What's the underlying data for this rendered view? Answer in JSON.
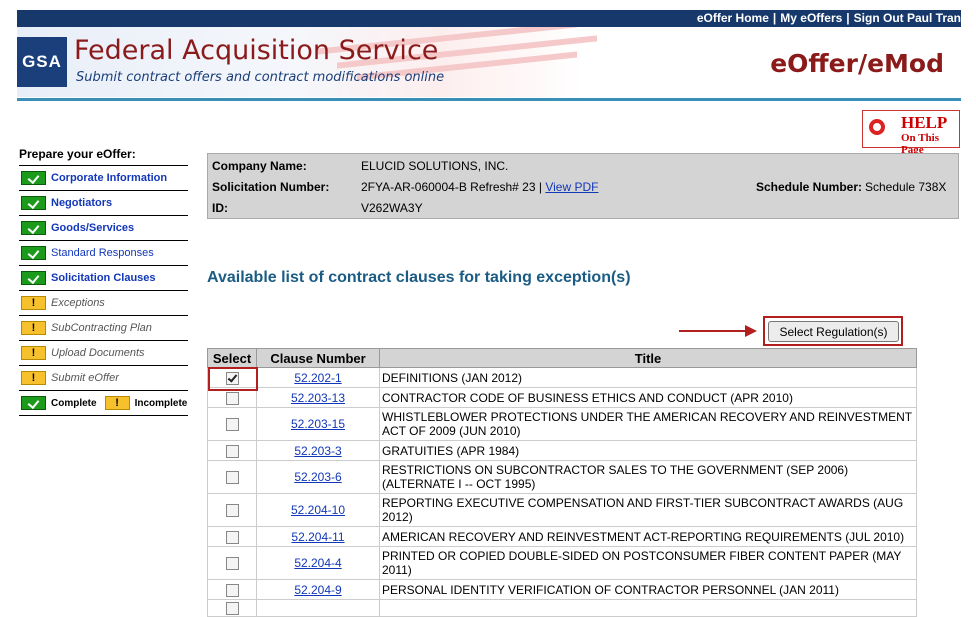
{
  "topnav": {
    "home": "eOffer Home",
    "my": "My eOffers",
    "signout": "Sign Out Paul Tran",
    "sep": "|"
  },
  "header": {
    "logo": "GSA",
    "title": "Federal Acquisition Service",
    "subtitle": "Submit contract offers and contract modifications online",
    "app": "eOffer/eMod"
  },
  "help": {
    "line1": "HELP",
    "line2": "On This Page"
  },
  "sidebar": {
    "heading": "Prepare your eOffer:",
    "items": [
      {
        "label": "Corporate Information",
        "status": "complete"
      },
      {
        "label": "Negotiators",
        "status": "complete"
      },
      {
        "label": "Goods/Services",
        "status": "complete"
      },
      {
        "label": "Standard Responses",
        "status": "complete"
      },
      {
        "label": "Solicitation Clauses",
        "status": "complete"
      },
      {
        "label": "Exceptions",
        "status": "incomplete"
      },
      {
        "label": "SubContracting Plan",
        "status": "incomplete"
      },
      {
        "label": "Upload Documents",
        "status": "incomplete"
      },
      {
        "label": "Submit eOffer",
        "status": "incomplete"
      }
    ],
    "legend": {
      "complete": "Complete",
      "incomplete": "Incomplete"
    }
  },
  "info": {
    "company_label": "Company Name:",
    "company": "ELUCID SOLUTIONS, INC.",
    "solicitation_label": "Solicitation Number:",
    "solicitation": "2FYA-AR-060004-B Refresh# 23 |",
    "view_pdf": "View PDF",
    "schedule_label": "Schedule Number:",
    "schedule": "Schedule 738X",
    "id_label": "ID:",
    "id": "V262WA3Y"
  },
  "section_title": "Available list of contract clauses for taking exception(s)",
  "select_regulation": "Select Regulation(s)",
  "table": {
    "headers": [
      "Select",
      "Clause Number",
      "Title"
    ],
    "rows": [
      {
        "checked": true,
        "number": "52.202-1",
        "title": "DEFINITIONS (JAN 2012)"
      },
      {
        "checked": false,
        "number": "52.203-13",
        "title": "CONTRACTOR CODE OF BUSINESS ETHICS AND CONDUCT (APR 2010)"
      },
      {
        "checked": false,
        "number": "52.203-15",
        "title": "WHISTLEBLOWER PROTECTIONS UNDER THE AMERICAN RECOVERY AND REINVESTMENT ACT OF 2009 (JUN 2010)"
      },
      {
        "checked": false,
        "number": "52.203-3",
        "title": "GRATUITIES (APR 1984)"
      },
      {
        "checked": false,
        "number": "52.203-6",
        "title": "RESTRICTIONS ON SUBCONTRACTOR SALES TO THE GOVERNMENT (SEP 2006) (ALTERNATE I -- OCT 1995)"
      },
      {
        "checked": false,
        "number": "52.204-10",
        "title": "REPORTING EXECUTIVE COMPENSATION AND FIRST-TIER SUBCONTRACT AWARDS (AUG 2012)"
      },
      {
        "checked": false,
        "number": "52.204-11",
        "title": "AMERICAN RECOVERY AND REINVESTMENT ACT-REPORTING REQUIREMENTS (JUL 2010)"
      },
      {
        "checked": false,
        "number": "52.204-4",
        "title": "PRINTED OR COPIED DOUBLE-SIDED ON POSTCONSUMER FIBER CONTENT PAPER (MAY 2011)"
      },
      {
        "checked": false,
        "number": "52.204-9",
        "title": "PERSONAL IDENTITY VERIFICATION OF CONTRACTOR PERSONNEL (JAN 2011)"
      },
      {
        "checked": false,
        "number": "",
        "title": ""
      }
    ]
  }
}
